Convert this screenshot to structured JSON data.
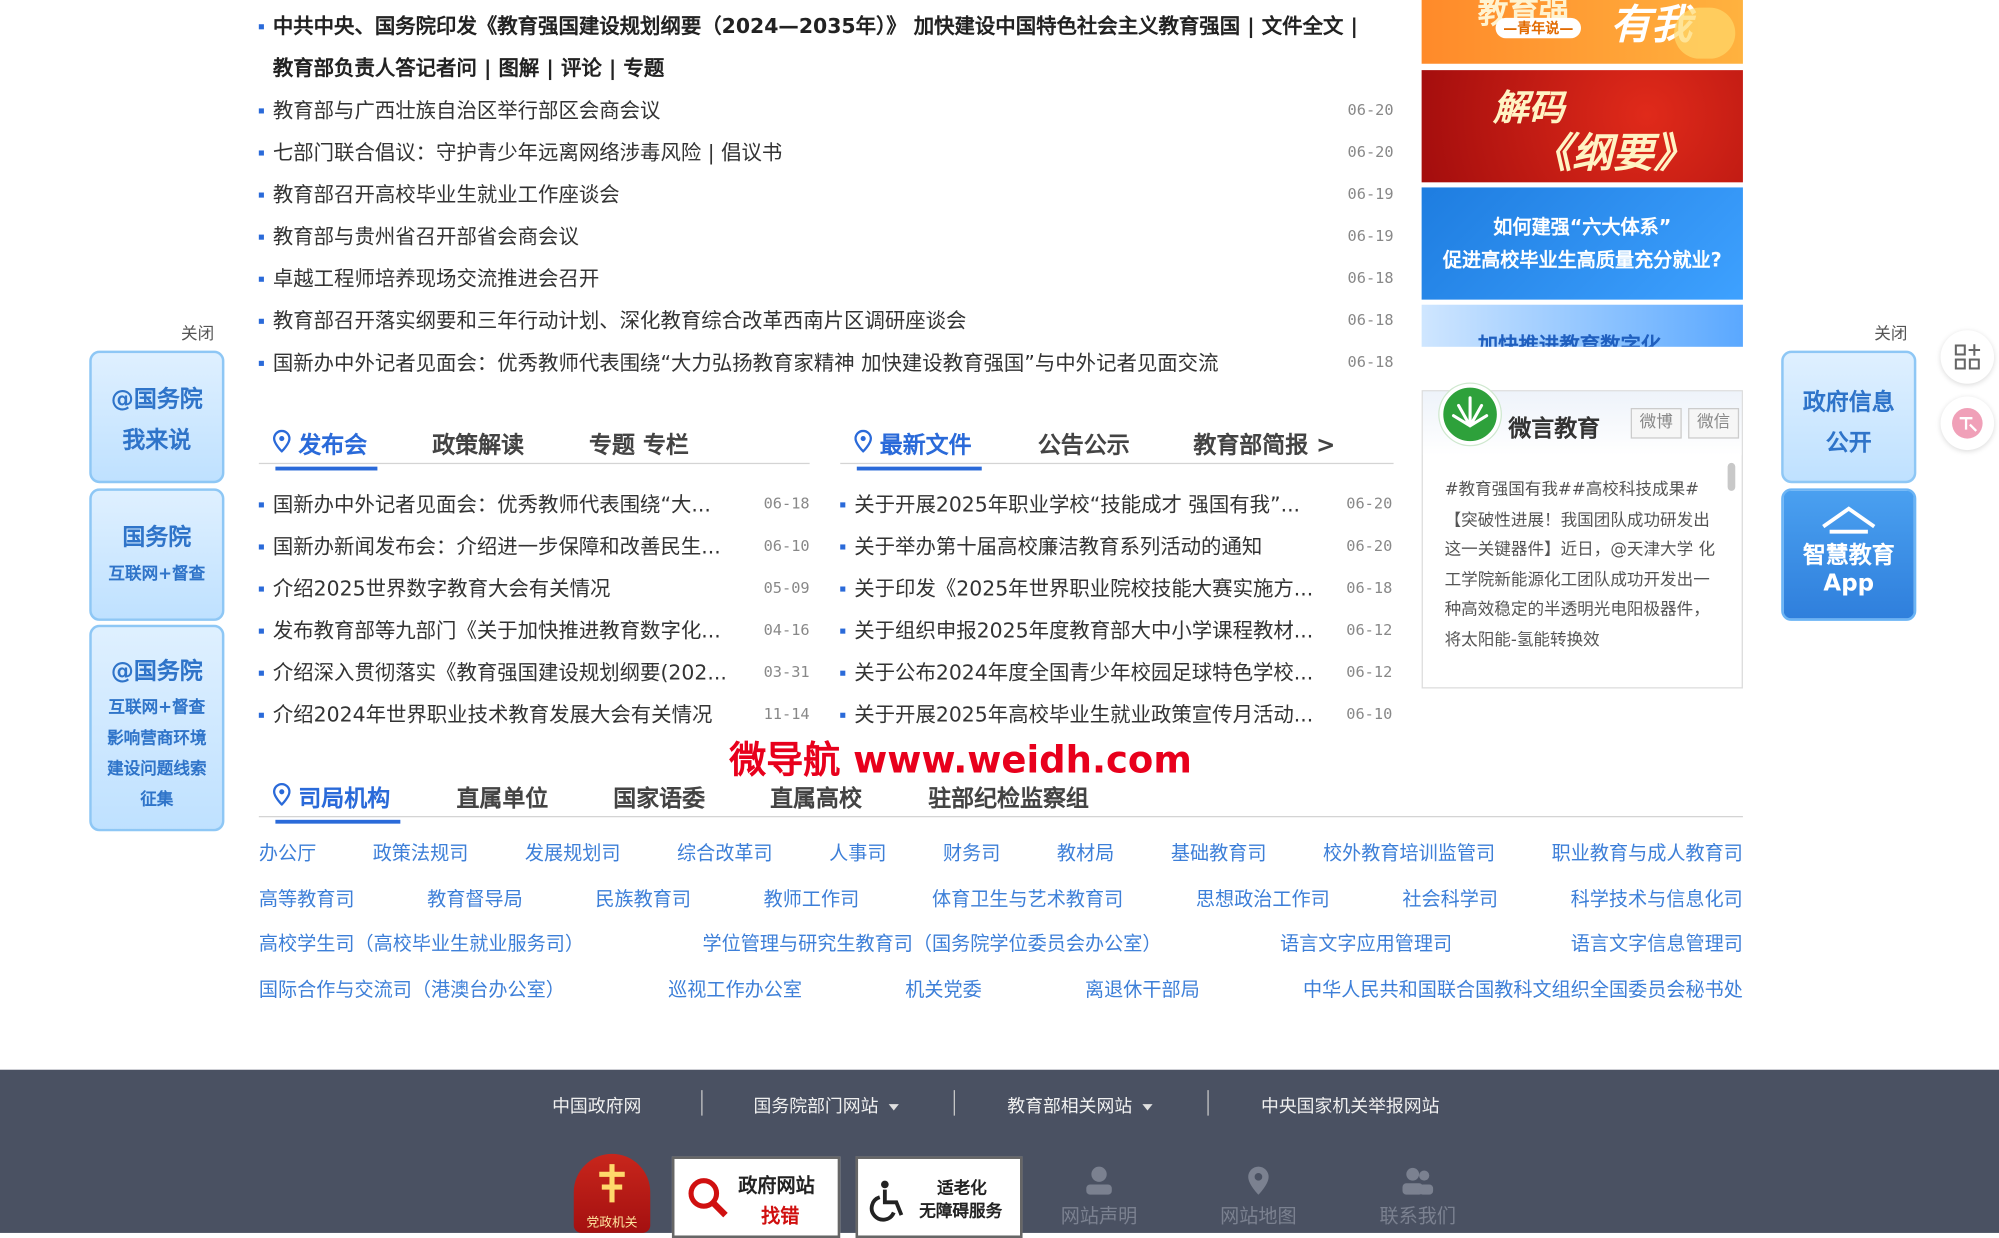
{
  "headlines": {
    "lead_line1": "中共中央、国务院印发《教育强国建设规划纲要（2024—2035年）》 加快建设中国特色社会主义教育强国 | 文件全文 |",
    "lead_line2": "教育部负责人答记者问 | 图解 | 评论 | 专题",
    "items": [
      {
        "text": "教育部与广西壮族自治区举行部区会商会议",
        "date": "06-20"
      },
      {
        "text": "七部门联合倡议：守护青少年远离网络涉毒风险 | 倡议书",
        "date": "06-20"
      },
      {
        "text": "教育部召开高校毕业生就业工作座谈会",
        "date": "06-19"
      },
      {
        "text": "教育部与贵州省召开部省会商会议",
        "date": "06-19"
      },
      {
        "text": "卓越工程师培养现场交流推进会召开",
        "date": "06-18"
      },
      {
        "text": "教育部召开落实纲要和三年行动计划、深化教育综合改革西南片区调研座谈会",
        "date": "06-18"
      },
      {
        "text": "国新办中外记者见面会：优秀教师代表围绕“大力弘扬教育家精神 加快建设教育强国”与中外记者见面交流",
        "date": "06-18"
      }
    ]
  },
  "left_tabs": {
    "tabs": [
      "发布会",
      "政策解读",
      "专题 专栏"
    ],
    "items": [
      {
        "text": "国新办中外记者见面会：优秀教师代表围绕“大...",
        "date": "06-18"
      },
      {
        "text": "国新办新闻发布会：介绍进一步保障和改善民生...",
        "date": "06-10"
      },
      {
        "text": "介绍2025世界数字教育大会有关情况",
        "date": "05-09"
      },
      {
        "text": "发布教育部等九部门《关于加快推进教育数字化...",
        "date": "04-16"
      },
      {
        "text": "介绍深入贯彻落实《教育强国建设规划纲要(202...",
        "date": "03-31"
      },
      {
        "text": "介绍2024年世界职业技术教育发展大会有关情况",
        "date": "11-14"
      }
    ]
  },
  "right_tabs": {
    "tabs": [
      "最新文件",
      "公告公示",
      "教育部简报 >"
    ],
    "items": [
      {
        "text": "关于开展2025年职业学校“技能成才 强国有我”...",
        "date": "06-20"
      },
      {
        "text": "关于举办第十届高校廉洁教育系列活动的通知",
        "date": "06-20"
      },
      {
        "text": "关于印发《2025年世界职业院校技能大赛实施方...",
        "date": "06-18"
      },
      {
        "text": "关于组织申报2025年度教育部大中小学课程教材...",
        "date": "06-12"
      },
      {
        "text": "关于公布2024年度全国青少年校园足球特色学校...",
        "date": "06-12"
      },
      {
        "text": "关于开展2025年高校毕业生就业政策宣传月活动...",
        "date": "06-10"
      }
    ]
  },
  "watermark": "微导航 www.weidh.com",
  "org_tabs": [
    "司局机构",
    "直属单位",
    "国家语委",
    "直属高校",
    "驻部纪检监察组"
  ],
  "departments": [
    [
      "办公厅",
      "政策法规司",
      "发展规划司",
      "综合改革司",
      "人事司",
      "财务司",
      "教材局",
      "基础教育司",
      "校外教育培训监管司",
      "职业教育与成人教育司"
    ],
    [
      "高等教育司",
      "教育督导局",
      "民族教育司",
      "教师工作司",
      "体育卫生与艺术教育司",
      "思想政治工作司",
      "社会科学司",
      "科学技术与信息化司"
    ],
    [
      "高校学生司（高校毕业生就业服务司）",
      "学位管理与研究生教育司（国务院学位委员会办公室）",
      "语言文字应用管理司",
      "语言文字信息管理司"
    ],
    [
      "国际合作与交流司（港澳台办公室）",
      "巡视工作办公室",
      "机关党委",
      "离退休干部局",
      "中华人民共和国联合国教科文组织全国委员会秘书处"
    ]
  ],
  "banners": {
    "b1": "有我",
    "b1_sub": "—青年说—",
    "b1_top": "教育强",
    "b2": "解码《纲要》",
    "b2_line1": "解码",
    "b2_line2": "《纲要》",
    "b3_line1": "如何建强“六大体系”",
    "b3_line2": "促进高校毕业生高质量充分就业?",
    "b4": "加快推进教育数字化"
  },
  "weibo": {
    "title": "微言教育",
    "btn_weibo": "微博",
    "btn_weixin": "微信",
    "text": "#教育强国有我##高校科技成果#【突破性进展！我国团队成功研发出这一关键器件】近日，@天津大学 化工学院新能源化工团队成功开发出一种高效稳定的半透明光电阳极器件，将太阳能-氢能转换效"
  },
  "left_float": {
    "close": "关闭",
    "box1_l1": "@国务院",
    "box1_l2": "我来说",
    "box2_l1": "国务院",
    "box2_l2": "互联网+督查",
    "box3_l1": "@国务院",
    "box3_l2": "互联网+督查",
    "box3_l3": "影响营商环境",
    "box3_l4": "建设问题线索",
    "box3_l5": "征集"
  },
  "right_float": {
    "close": "关闭",
    "box1_l1": "政府信息",
    "box1_l2": "公开",
    "box2_l1": "智慧教育",
    "box2_l2": "App"
  },
  "footer": {
    "links": [
      "中国政府网",
      "国务院部门网站",
      "教育部相关网站",
      "中央国家机关举报网站"
    ],
    "badge_party": "党政机关",
    "badge_error_l1": "政府网站",
    "badge_error_l2": "找错",
    "badge_access_l1": "适老化",
    "badge_access_l2": "无障碍服务",
    "statement": "网站声明",
    "sitemap": "网站地图",
    "contact": "联系我们"
  },
  "colors": {
    "accent": "#2a6ad9",
    "dept_link": "#3d7fd8",
    "footer_bg": "#4a5162",
    "watermark": "#e8001c"
  }
}
